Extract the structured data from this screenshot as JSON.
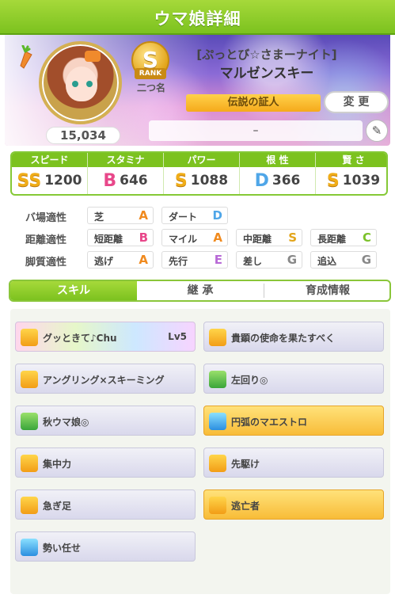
{
  "header": {
    "title": "ウマ娘詳細"
  },
  "profile": {
    "score": "15,034",
    "rank_letter": "S",
    "rank_label": "RANK",
    "nickname": "二つ名",
    "epithet": "[ぷっとび☆さまーナイト]",
    "name": "マルゼンスキー",
    "title_badge": "伝説の証人",
    "change_button": "変 更",
    "memo": "–"
  },
  "stats": [
    {
      "label": "スピード",
      "grade": "SS",
      "value": "1200"
    },
    {
      "label": "スタミナ",
      "grade": "B",
      "value": "646"
    },
    {
      "label": "パワー",
      "grade": "S",
      "value": "1088"
    },
    {
      "label": "根 性",
      "grade": "D",
      "value": "366"
    },
    {
      "label": "賢 さ",
      "grade": "S",
      "value": "1039"
    }
  ],
  "aptitude": {
    "track": {
      "label": "バ場適性",
      "items": [
        {
          "t": "芝",
          "l": "A"
        },
        {
          "t": "ダート",
          "l": "D"
        }
      ]
    },
    "distance": {
      "label": "距離適性",
      "items": [
        {
          "t": "短距離",
          "l": "B"
        },
        {
          "t": "マイル",
          "l": "A"
        },
        {
          "t": "中距離",
          "l": "S"
        },
        {
          "t": "長距離",
          "l": "C"
        }
      ]
    },
    "style": {
      "label": "脚質適性",
      "items": [
        {
          "t": "逃げ",
          "l": "A"
        },
        {
          "t": "先行",
          "l": "E"
        },
        {
          "t": "差し",
          "l": "G"
        },
        {
          "t": "追込",
          "l": "G"
        }
      ]
    }
  },
  "tabs": [
    "スキル",
    "継 承",
    "育成情報"
  ],
  "skills": [
    {
      "name": "グッときて♪Chu",
      "level": "Lv5",
      "style": "rainbow",
      "icon": "gold"
    },
    {
      "name": "貴顕の使命を果たすべく",
      "level": "",
      "style": "normal",
      "icon": "gold"
    },
    {
      "name": "アングリング×スキーミング",
      "level": "",
      "style": "normal",
      "icon": "gold"
    },
    {
      "name": "左回り◎",
      "level": "",
      "style": "normal",
      "icon": "green"
    },
    {
      "name": "秋ウマ娘◎",
      "level": "",
      "style": "normal",
      "icon": "green"
    },
    {
      "name": "円弧のマエストロ",
      "level": "",
      "style": "gold",
      "icon": "blue"
    },
    {
      "name": "集中力",
      "level": "",
      "style": "normal",
      "icon": "gold"
    },
    {
      "name": "先駆け",
      "level": "",
      "style": "normal",
      "icon": "gold"
    },
    {
      "name": "急ぎ足",
      "level": "",
      "style": "normal",
      "icon": "gold"
    },
    {
      "name": "逃亡者",
      "level": "",
      "style": "gold",
      "icon": "gold"
    },
    {
      "name": "勢い任せ",
      "level": "",
      "style": "normal",
      "icon": "blue"
    }
  ]
}
